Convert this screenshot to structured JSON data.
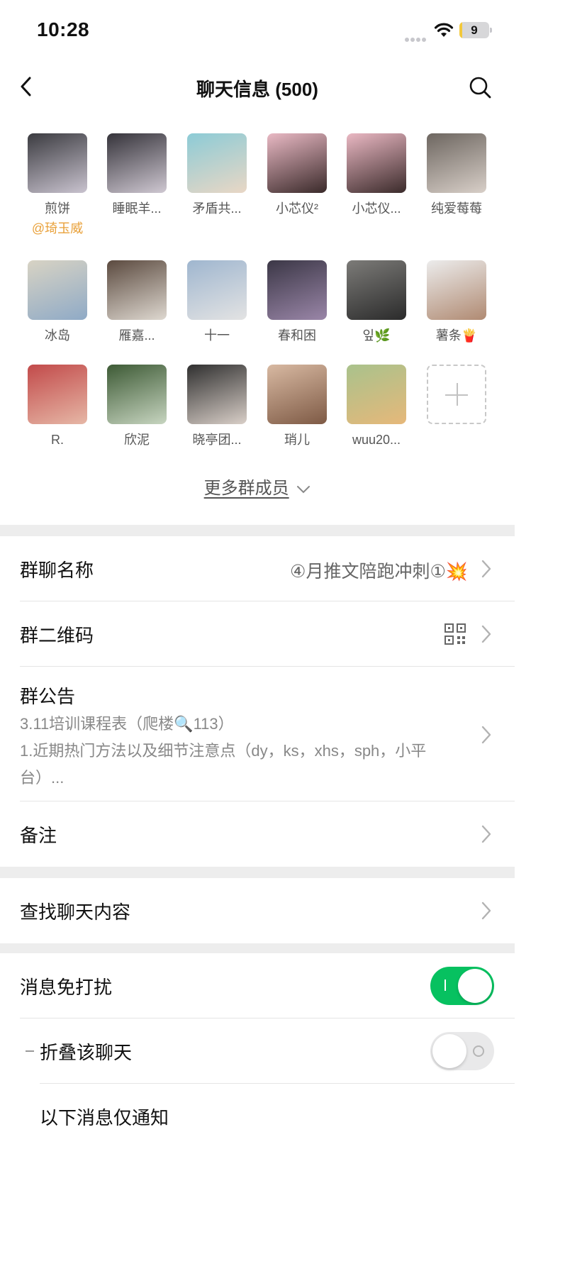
{
  "status": {
    "time": "10:28",
    "battery": "9",
    "battery_level": 0.09
  },
  "nav": {
    "title": "聊天信息 (500)"
  },
  "members": [
    {
      "name": "煎饼",
      "mention": "@琦玉威",
      "avatar_colors": [
        "#3b3b40",
        "#c9c3cf"
      ]
    },
    {
      "name": "睡眠羊...",
      "avatar_colors": [
        "#35333a",
        "#cfc8d2"
      ]
    },
    {
      "name": "矛盾共...",
      "avatar_colors": [
        "#8ccbd6",
        "#e9d7c5"
      ]
    },
    {
      "name": "小芯仪²",
      "avatar_colors": [
        "#e9b9c4",
        "#3a2a2a"
      ]
    },
    {
      "name": "小芯仪...",
      "avatar_colors": [
        "#eab8c3",
        "#3b2b2b"
      ]
    },
    {
      "name": "纯爱莓莓",
      "avatar_colors": [
        "#6d6660",
        "#d8cfc8"
      ]
    },
    {
      "name": "冰岛",
      "avatar_colors": [
        "#d8d3c4",
        "#8faac6"
      ]
    },
    {
      "name": "雁嘉...",
      "avatar_colors": [
        "#5b4a3f",
        "#ded8d0"
      ]
    },
    {
      "name": "十一",
      "avatar_colors": [
        "#9fb6cf",
        "#e3e3e3"
      ]
    },
    {
      "name": "春和困",
      "avatar_colors": [
        "#3b3746",
        "#9a86a8"
      ]
    },
    {
      "name": "잎🌿",
      "avatar_colors": [
        "#7c7b78",
        "#2b2b2b"
      ]
    },
    {
      "name": "薯条🍟",
      "avatar_colors": [
        "#ececec",
        "#b08a72"
      ]
    },
    {
      "name": "R.",
      "avatar_colors": [
        "#c24a4a",
        "#e6b7a6"
      ]
    },
    {
      "name": "欣泥",
      "avatar_colors": [
        "#3d5a35",
        "#c7d5c0"
      ]
    },
    {
      "name": "晓亭团...",
      "avatar_colors": [
        "#2f2f2f",
        "#d9cfc8"
      ]
    },
    {
      "name": "琑儿",
      "avatar_colors": [
        "#d8b9a2",
        "#7e5a45"
      ]
    },
    {
      "name": "wuu20...",
      "avatar_colors": [
        "#a9c28c",
        "#e6b87a"
      ]
    }
  ],
  "more_members": "更多群成员",
  "settings": {
    "group_name_label": "群聊名称",
    "group_name_value": "④月推文陪跑冲刺①💥",
    "qr_label": "群二维码",
    "announcement_label": "群公告",
    "announcement_line1": "3.11培训课程表（爬楼🔍113）",
    "announcement_line2": "1.近期热门方法以及细节注意点（dy，ks，xhs，sph，小平台）...",
    "remark_label": "备注",
    "search_label": "查找聊天内容",
    "mute_label": "消息免打扰",
    "mute_on": true,
    "fold_label": "折叠该聊天",
    "fold_on": false,
    "next_label": "以下消息仅通知"
  },
  "colors": {
    "accent_green": "#07c160",
    "mention_orange": "#e9a13a",
    "gap_gray": "#ededed"
  }
}
